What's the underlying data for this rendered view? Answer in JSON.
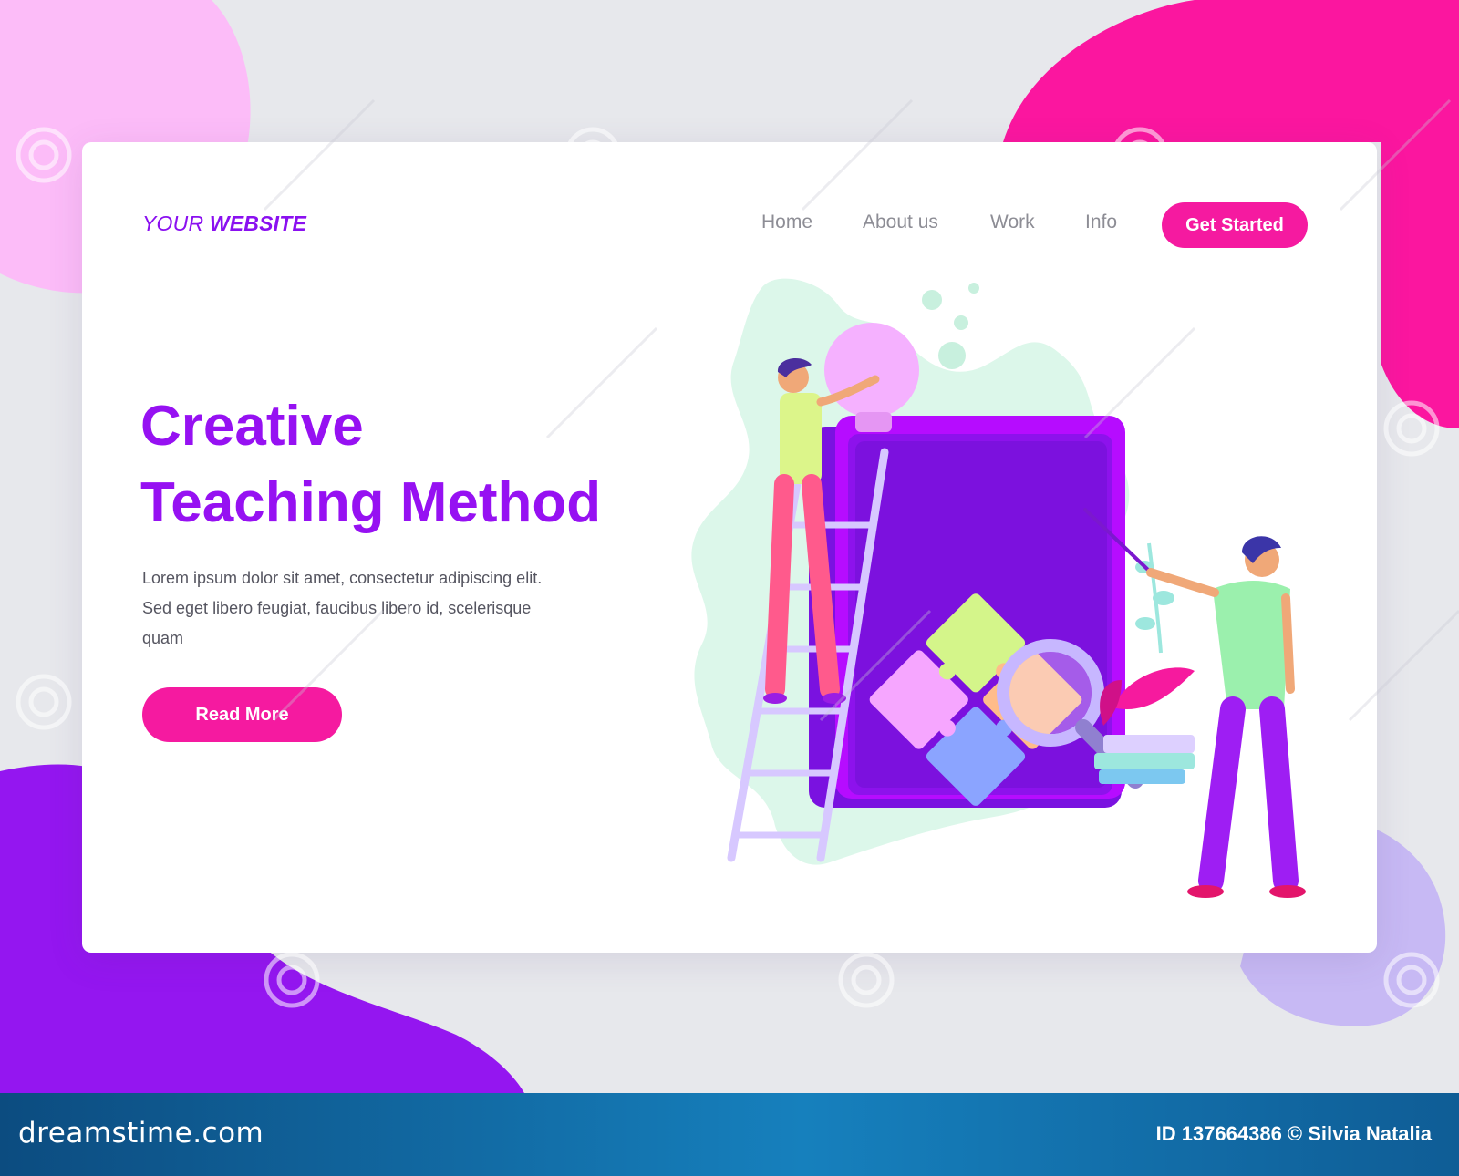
{
  "logo": {
    "prefix": "YOUR",
    "bold": "WEBSITE"
  },
  "nav": {
    "home": "Home",
    "about": "About us",
    "work": "Work",
    "info": "Info"
  },
  "cta": {
    "label": "Get Started"
  },
  "hero": {
    "title_line1": "Creative",
    "title_line2": "Teaching Method",
    "description": "Lorem ipsum dolor sit amet, consectetur adipiscing elit. Sed eget libero feugiat, faucibus libero id, scelerisque quam",
    "button_label": "Read More"
  },
  "footer": {
    "site": "dreamstime.com",
    "credit": "ID 137664386 © Silvia Natalia"
  },
  "colors": {
    "brand_purple": "#9611f2",
    "accent_pink": "#f51aa0",
    "background": "#e7e8ec",
    "footer_blue": "#1680bd"
  }
}
